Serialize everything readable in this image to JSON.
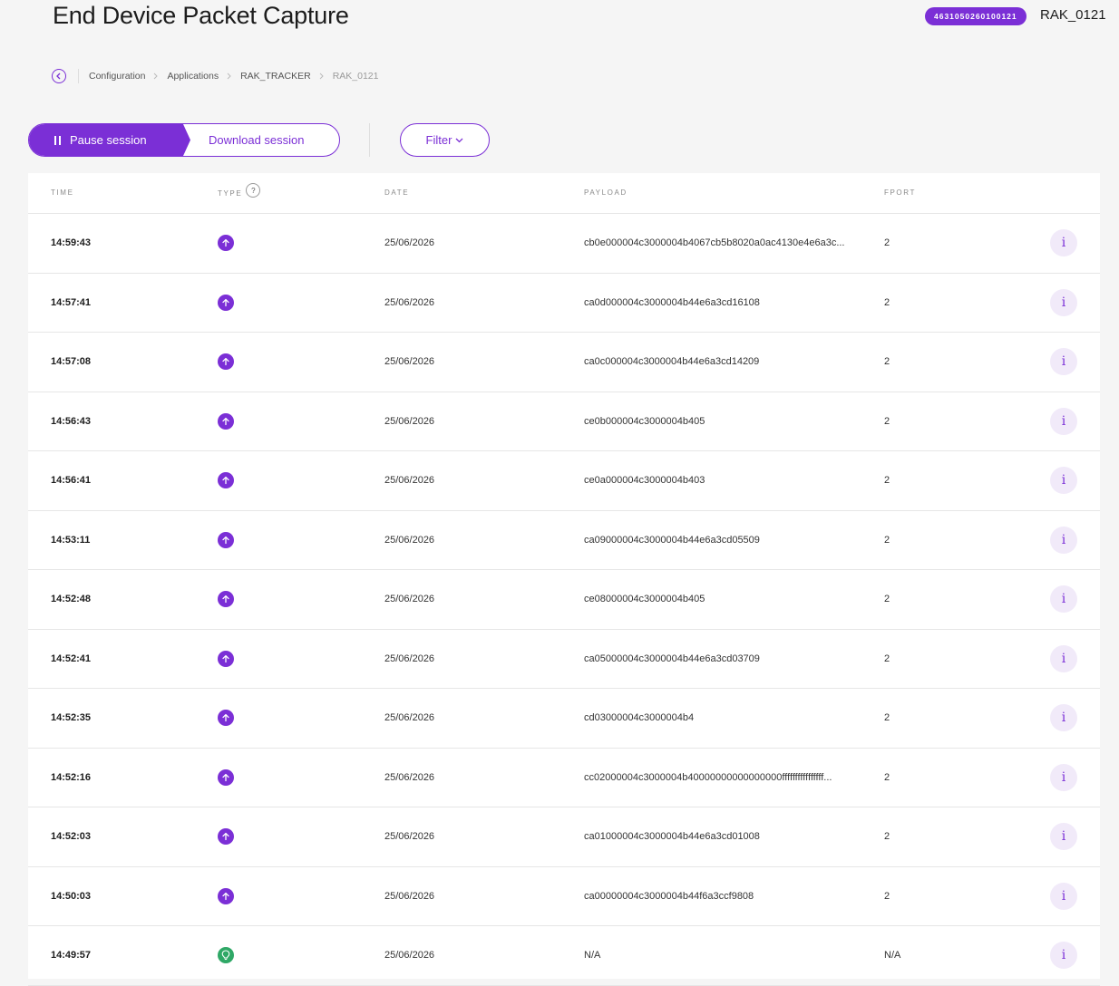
{
  "header": {
    "title": "End Device Packet Capture",
    "device_eui": "4631050260100121",
    "device_name": "RAK_0121"
  },
  "breadcrumb": {
    "back_icon": "chevron-left-icon",
    "items": [
      "Configuration",
      "Applications",
      "RAK_TRACKER",
      "RAK_0121"
    ]
  },
  "toolbar": {
    "pause_label": "Pause session",
    "download_label": "Download session",
    "filter_label": "Filter"
  },
  "table": {
    "headers": {
      "time": "TIME",
      "type": "TYPE",
      "type_help": "?",
      "date": "DATE",
      "payload": "PAYLOAD",
      "fport": "FPORT"
    },
    "info_label": "i",
    "rows": [
      {
        "time": "14:59:43",
        "type": "uplink",
        "date": "25/06/2026",
        "payload": "cb0e000004c3000004b4067cb5b8020a0ac4130e4e6a3c...",
        "fport": "2"
      },
      {
        "time": "14:57:41",
        "type": "uplink",
        "date": "25/06/2026",
        "payload": "ca0d000004c3000004b44e6a3cd16108",
        "fport": "2"
      },
      {
        "time": "14:57:08",
        "type": "uplink",
        "date": "25/06/2026",
        "payload": "ca0c000004c3000004b44e6a3cd14209",
        "fport": "2"
      },
      {
        "time": "14:56:43",
        "type": "uplink",
        "date": "25/06/2026",
        "payload": "ce0b000004c3000004b405",
        "fport": "2"
      },
      {
        "time": "14:56:41",
        "type": "uplink",
        "date": "25/06/2026",
        "payload": "ce0a000004c3000004b403",
        "fport": "2"
      },
      {
        "time": "14:53:11",
        "type": "uplink",
        "date": "25/06/2026",
        "payload": "ca09000004c3000004b44e6a3cd05509",
        "fport": "2"
      },
      {
        "time": "14:52:48",
        "type": "uplink",
        "date": "25/06/2026",
        "payload": "ce08000004c3000004b405",
        "fport": "2"
      },
      {
        "time": "14:52:41",
        "type": "uplink",
        "date": "25/06/2026",
        "payload": "ca05000004c3000004b44e6a3cd03709",
        "fport": "2"
      },
      {
        "time": "14:52:35",
        "type": "uplink",
        "date": "25/06/2026",
        "payload": "cd03000004c3000004b4",
        "fport": "2"
      },
      {
        "time": "14:52:16",
        "type": "uplink",
        "date": "25/06/2026",
        "payload": "cc02000004c3000004b40000000000000000ffffffffffffffff...",
        "fport": "2"
      },
      {
        "time": "14:52:03",
        "type": "uplink",
        "date": "25/06/2026",
        "payload": "ca01000004c3000004b44e6a3cd01008",
        "fport": "2"
      },
      {
        "time": "14:50:03",
        "type": "uplink",
        "date": "25/06/2026",
        "payload": "ca00000004c3000004b44f6a3ccf9808",
        "fport": "2"
      },
      {
        "time": "14:49:57",
        "type": "join",
        "date": "25/06/2026",
        "payload": "N/A",
        "fport": "N/A"
      }
    ]
  },
  "colors": {
    "accent": "#7b2fd6",
    "join": "#2fa866"
  }
}
